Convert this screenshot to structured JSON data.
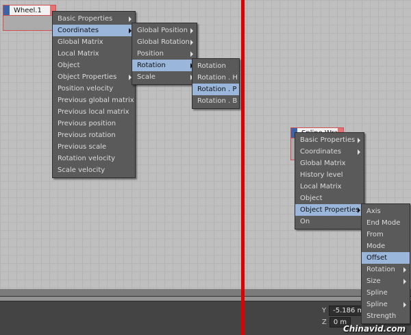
{
  "nodes": {
    "wheel": {
      "title": "Wheel.1"
    },
    "spline_wrap": {
      "title": "Spline Wrap"
    }
  },
  "menu_left_main": [
    {
      "label": "Basic Properties",
      "submenu": true
    },
    {
      "label": "Coordinates",
      "submenu": true,
      "highlighted": true
    },
    {
      "label": "Global Matrix"
    },
    {
      "label": "Local Matrix"
    },
    {
      "label": "Object"
    },
    {
      "label": "Object Properties",
      "submenu": true
    },
    {
      "label": "Position velocity"
    },
    {
      "label": "Previous global matrix"
    },
    {
      "label": "Previous local matrix"
    },
    {
      "label": "Previous position"
    },
    {
      "label": "Previous rotation"
    },
    {
      "label": "Previous scale"
    },
    {
      "label": "Rotation velocity"
    },
    {
      "label": "Scale velocity"
    }
  ],
  "menu_left_coords": [
    {
      "label": "Global Position",
      "submenu": true
    },
    {
      "label": "Global Rotation",
      "submenu": true
    },
    {
      "label": "Position",
      "submenu": true
    },
    {
      "label": "Rotation",
      "submenu": true,
      "highlighted": true
    },
    {
      "label": "Scale",
      "submenu": true
    }
  ],
  "menu_left_rotation": [
    {
      "label": "Rotation"
    },
    {
      "label": "Rotation . H"
    },
    {
      "label": "Rotation . P",
      "highlighted": true
    },
    {
      "label": "Rotation . B"
    }
  ],
  "menu_right_main": [
    {
      "label": "Basic Properties",
      "submenu": true
    },
    {
      "label": "Coordinates",
      "submenu": true
    },
    {
      "label": "Global Matrix"
    },
    {
      "label": "History level"
    },
    {
      "label": "Local Matrix"
    },
    {
      "label": "Object"
    },
    {
      "label": "Object Properties",
      "submenu": true,
      "highlighted": true
    },
    {
      "label": "On"
    }
  ],
  "menu_right_objprops": [
    {
      "label": "Axis"
    },
    {
      "label": "End Mode"
    },
    {
      "label": "From"
    },
    {
      "label": "Mode"
    },
    {
      "label": "Offset",
      "highlighted": true
    },
    {
      "label": "Rotation",
      "submenu": true
    },
    {
      "label": "Size",
      "submenu": true
    },
    {
      "label": "Spline"
    },
    {
      "label": "Spline",
      "submenu": true
    },
    {
      "label": "Strength"
    }
  ],
  "coords": {
    "y_label": "Y",
    "y_value": "-5.186 m",
    "z_label": "Z",
    "z_value": "0 m"
  },
  "watermark": "Chinavid.com"
}
